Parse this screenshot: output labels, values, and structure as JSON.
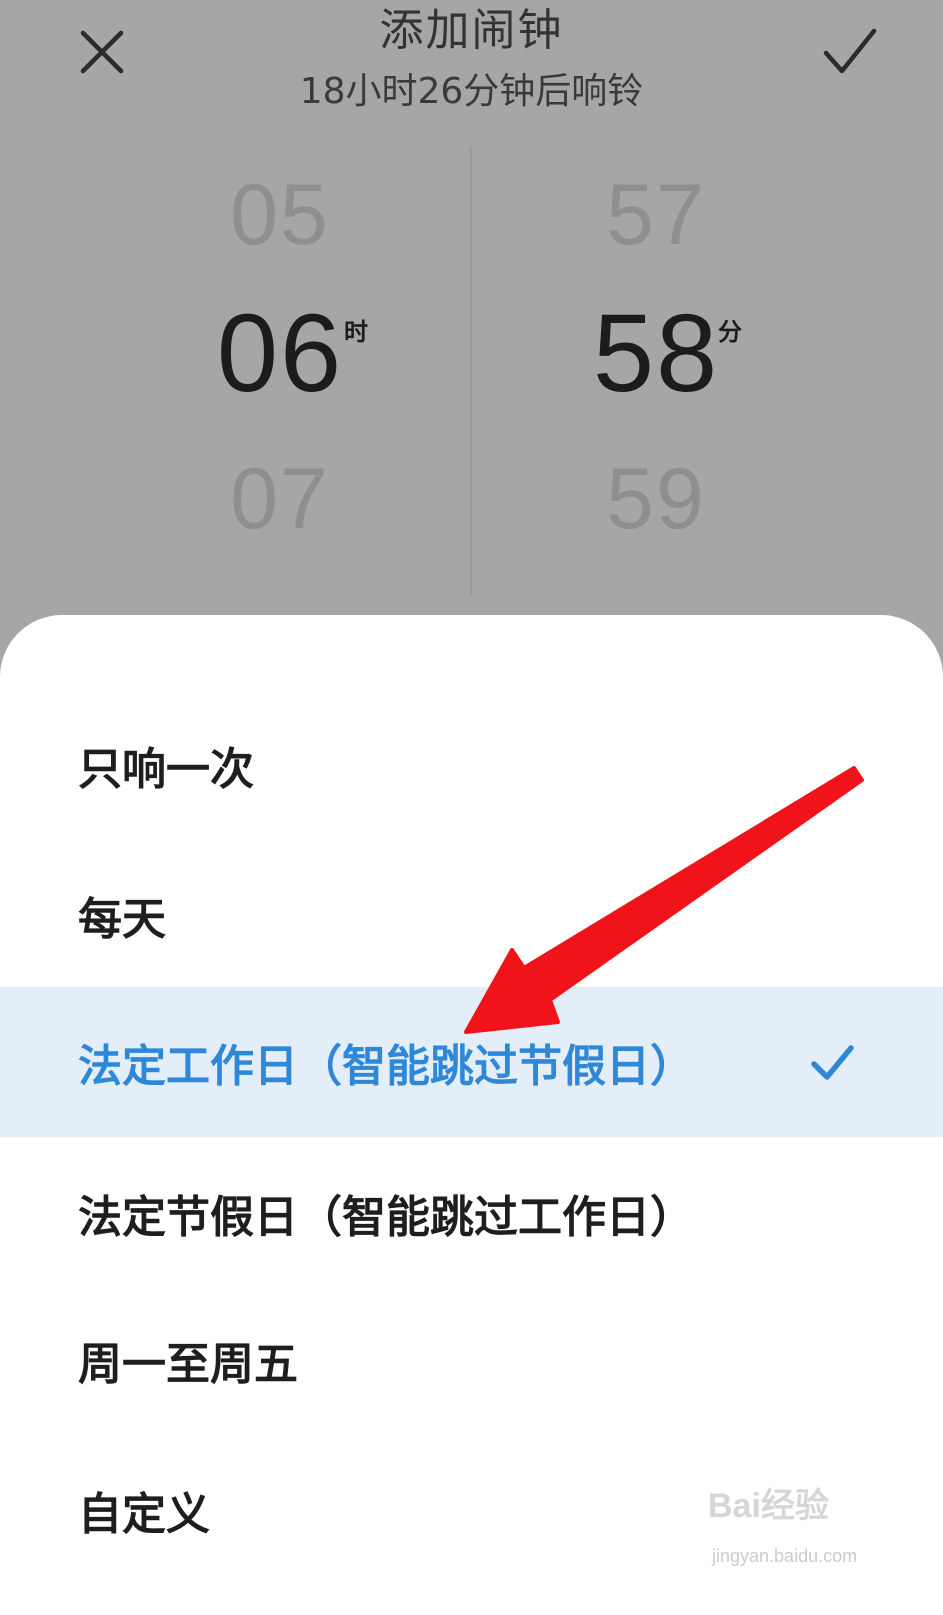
{
  "header": {
    "title": "添加闹钟",
    "subtitle": "18小时26分钟后响铃",
    "close_icon": "close-icon",
    "confirm_icon": "check-icon"
  },
  "picker": {
    "hour": {
      "prev": "05",
      "current": "06",
      "next": "07",
      "unit": "时"
    },
    "minute": {
      "prev": "57",
      "current": "58",
      "next": "59",
      "unit": "分"
    }
  },
  "repeat_options": [
    {
      "label": "只响一次",
      "selected": false
    },
    {
      "label": "每天",
      "selected": false
    },
    {
      "label": "法定工作日（智能跳过节假日）",
      "selected": true
    },
    {
      "label": "法定节假日（智能跳过工作日）",
      "selected": false
    },
    {
      "label": "周一至周五",
      "selected": false
    },
    {
      "label": "自定义",
      "selected": false
    }
  ],
  "colors": {
    "accent": "#2f87d8",
    "selected_bg": "#e3eef8",
    "annotation_arrow": "#f0141a"
  },
  "watermark": {
    "main": "Bai经验",
    "sub": "jingyan.baidu.com"
  }
}
